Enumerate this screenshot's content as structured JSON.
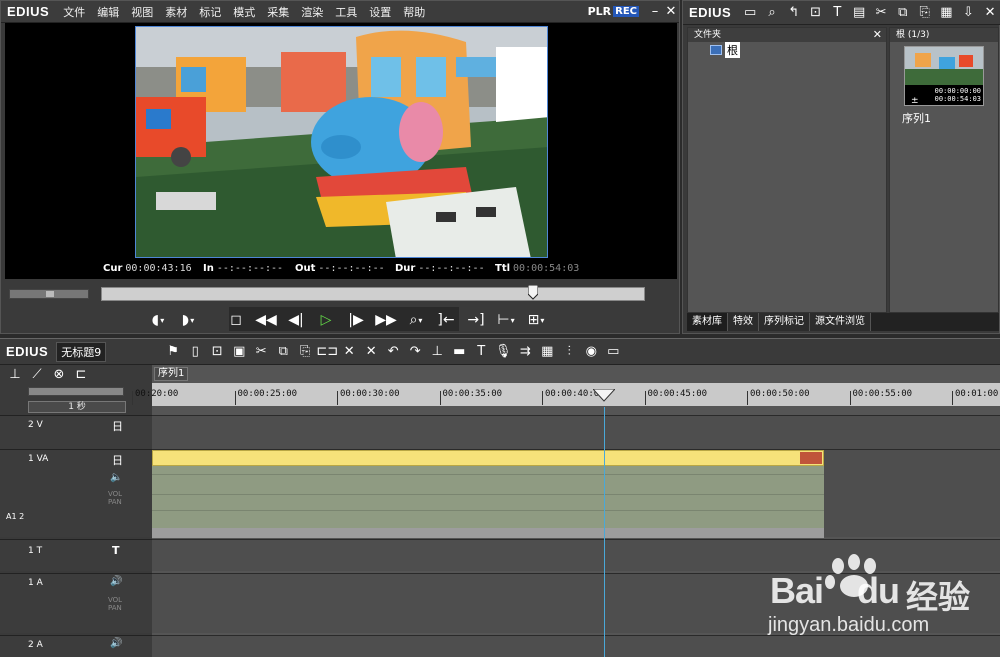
{
  "player": {
    "logo": "EDIUS",
    "menu": [
      "文件",
      "编辑",
      "视图",
      "素材",
      "标记",
      "模式",
      "采集",
      "渲染",
      "工具",
      "设置",
      "帮助"
    ],
    "plr": "PLR",
    "rec": "REC",
    "timecodes": {
      "cur_label": "Cur",
      "cur_value": "00:00:43:16",
      "in_label": "In",
      "in_value": "--:--:--:--",
      "out_label": "Out",
      "out_value": "--:--:--:--",
      "dur_label": "Dur",
      "dur_value": "--:--:--:--",
      "ttl_label": "Ttl",
      "ttl_value": "00:00:54:03"
    },
    "scrub_position": 0.8
  },
  "bin": {
    "logo": "EDIUS",
    "folder_pane_title": "文件夹",
    "root_label": "根",
    "clip_pane_title": "根 (1/3)",
    "clip": {
      "name": "序列1",
      "tc_in": "00:00:00:00",
      "tc_dur": "00:00:54:03"
    },
    "tabs": [
      "素材库",
      "特效",
      "序列标记",
      "源文件浏览"
    ]
  },
  "timeline": {
    "logo": "EDIUS",
    "sequence_title": "无标题9",
    "sequence_tab": "序列1",
    "scale": "1 秒",
    "ruler": [
      "00:20:00",
      "00:00:25:00",
      "00:00:30:00",
      "00:00:35:00",
      "00:00:40:00",
      "00:00:45:00",
      "00:00:50:00",
      "00:00:55:00",
      "00:01:00:0"
    ],
    "tracks": [
      {
        "id": "2 V"
      },
      {
        "id": "1 VA"
      },
      {
        "id": "1 T"
      },
      {
        "id": "1 A"
      },
      {
        "id": "2 A"
      }
    ],
    "vol_label": "VOL",
    "pan_label": "PAN",
    "a12_label": "A1 2"
  },
  "watermark": {
    "brand": "Bai",
    "brand2": "du",
    "cn": "经验",
    "url": "jingyan.baidu.com"
  },
  "colors": {
    "rec": "#2457b8",
    "clip_header": "#f6e27a",
    "clip_body": "#8f9b82",
    "cursor": "#4aa8d8",
    "play": "#66e04a"
  }
}
